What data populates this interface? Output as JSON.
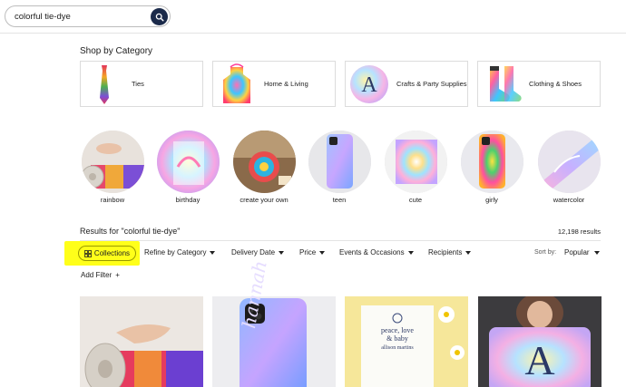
{
  "search": {
    "value": "colorful tie-dye",
    "button_icon": "search-icon"
  },
  "shop_by_category": {
    "title": "Shop by Category",
    "items": [
      {
        "label": "Ties"
      },
      {
        "label": "Home & Living"
      },
      {
        "label": "Crafts & Party Supplies"
      },
      {
        "label": "Clothing & Shoes"
      }
    ]
  },
  "related": [
    {
      "label": "rainbow"
    },
    {
      "label": "birthday"
    },
    {
      "label": "create your own"
    },
    {
      "label": "teen"
    },
    {
      "label": "cute"
    },
    {
      "label": "girly"
    },
    {
      "label": "watercolor"
    }
  ],
  "results": {
    "title": "Results for \"colorful tie-dye\"",
    "count": "12,198 results"
  },
  "filters": {
    "collections": "Collections",
    "items": [
      {
        "label": "Refine by Category"
      },
      {
        "label": "Delivery Date"
      },
      {
        "label": "Price"
      },
      {
        "label": "Events & Occasions"
      },
      {
        "label": "Recipients"
      }
    ],
    "sort_label": "Sort by:",
    "sort_value": "Popular",
    "add_filter": "Add Filter",
    "add_icon": "+"
  },
  "products": [
    {
      "name": "tie-dye yoga mat"
    },
    {
      "name": "tie-dye phone case",
      "script": "hannah"
    },
    {
      "name": "peace love baby invitation",
      "line1": "peace, love",
      "line2": "& baby",
      "line3": "allison martins"
    },
    {
      "name": "monogram tie-dye pillow",
      "letter": "A"
    }
  ],
  "colors": {
    "accent": "#1b2a4a",
    "highlight": "#ffff1a",
    "border": "#dcdcdc"
  }
}
